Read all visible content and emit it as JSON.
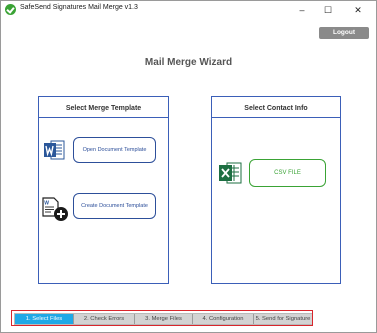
{
  "window": {
    "title": "SafeSend Signatures Mail Merge v1.3",
    "controls": {
      "minimize": "–",
      "maximize": "☐",
      "close": "✕"
    }
  },
  "header": {
    "logout_label": "Logout",
    "wizard_title": "Mail Merge Wizard"
  },
  "template_panel": {
    "title": "Select Merge Template",
    "open_button": "Open Document Template",
    "create_button": "Create Document Template",
    "icons": [
      "word-icon",
      "new-document-icon"
    ]
  },
  "contact_panel": {
    "title": "Select Contact Info",
    "csv_button": "CSV FILE",
    "icons": [
      "excel-icon"
    ]
  },
  "steps": {
    "items": [
      {
        "label": "1. Select Files",
        "active": true
      },
      {
        "label": "2. Check Errors",
        "active": false
      },
      {
        "label": "3. Merge Files",
        "active": false
      },
      {
        "label": "4. Configuration",
        "active": false
      },
      {
        "label": "5. Send for Signature",
        "active": false
      }
    ]
  },
  "colors": {
    "panel_border": "#3b5fb8",
    "open_button": "#2d4f9a",
    "csv_button": "#3aa335",
    "active_step": "#1fa8e6",
    "step_highlight_border": "#d9262c",
    "logout_bg": "#8a8a8a"
  }
}
